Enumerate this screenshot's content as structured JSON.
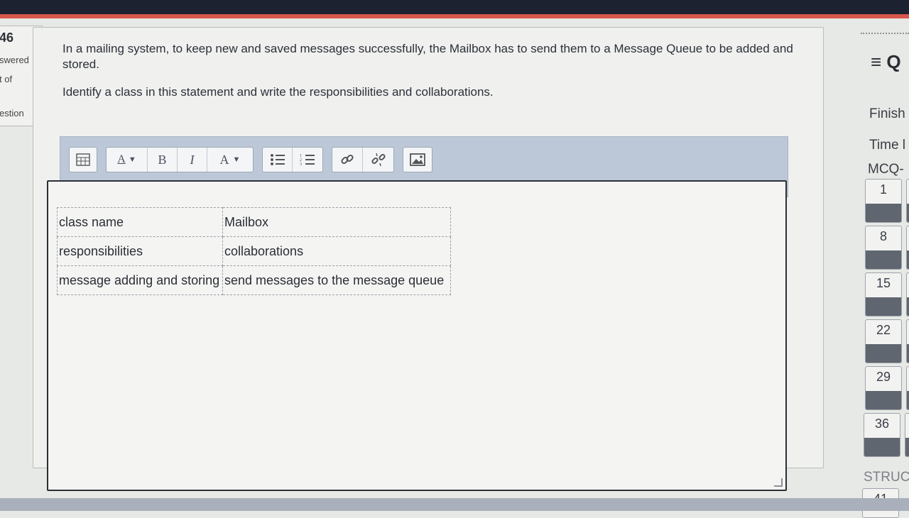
{
  "left_info": {
    "number": "46",
    "answered": "swered",
    "out_of": "t of",
    "question": "estion"
  },
  "question": {
    "text1": "In a mailing system, to keep new and saved messages successfully, the Mailbox has to send them to a Message Queue to be added and stored.",
    "text2": "Identify a class in this statement and write the responsibilities and collaborations."
  },
  "toolbar": {
    "icons": [
      "grid-icon",
      "font-size-icon",
      "bold-icon",
      "italic-icon",
      "font-color-icon",
      "bullet-list-icon",
      "numbered-list-icon",
      "link-icon",
      "unlink-icon",
      "image-icon"
    ],
    "font_size_label": "A",
    "bold_label": "B",
    "italic_label": "I",
    "font_color_label": "A"
  },
  "answer_table": {
    "rows": [
      [
        "class name",
        "Mailbox"
      ],
      [
        "responsibilities",
        "collaborations"
      ],
      [
        "message adding and storing",
        "send messages to the message queue"
      ]
    ]
  },
  "nav": {
    "title": "≡ Q",
    "finish": "Finish",
    "time": "Time l",
    "section_mcq": "MCQ-",
    "mcq_numbers": [
      "1",
      "8",
      "15",
      "22",
      "29",
      "36"
    ],
    "section_struc": "STRUC",
    "struc_numbers": [
      "41"
    ]
  }
}
